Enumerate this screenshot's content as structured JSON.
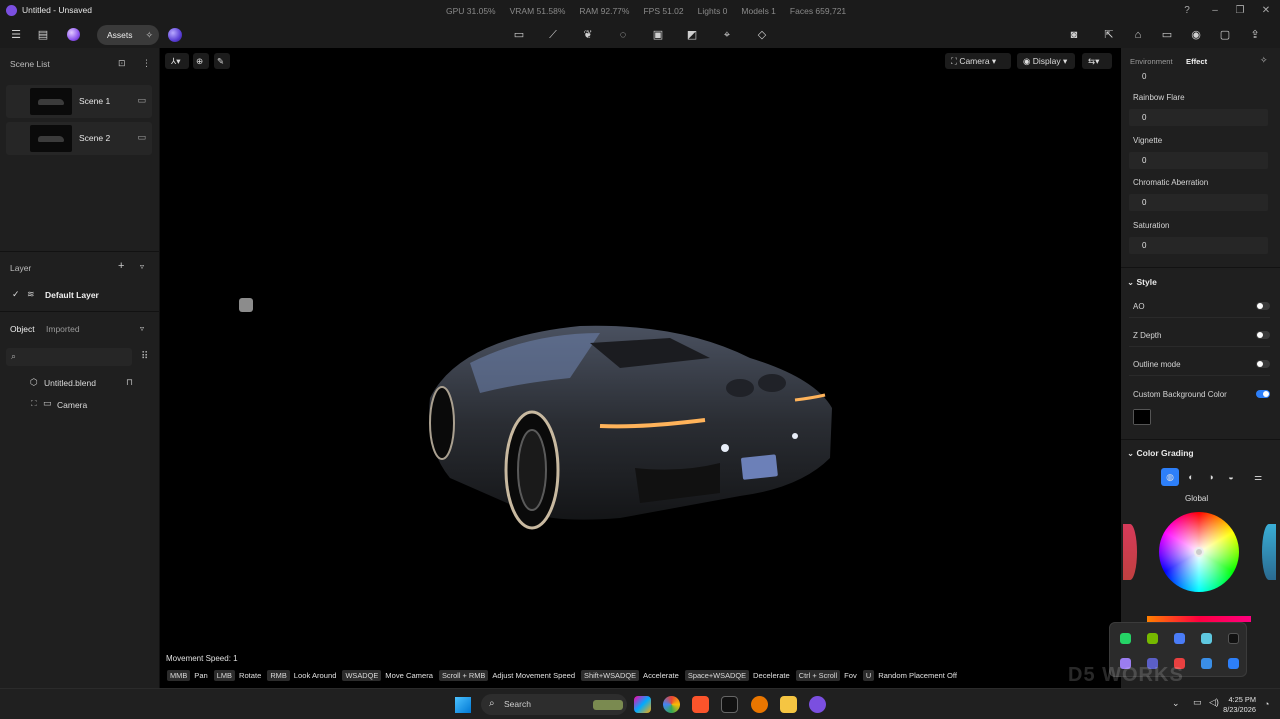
{
  "window": {
    "title": "Untitled - Unsaved"
  },
  "stats": {
    "gpu": "GPU 31.05%",
    "vram": "VRAM 51.58%",
    "ram": "RAM 92.77%",
    "fps": "FPS 51.02",
    "lights": "Lights 0",
    "models": "Models 1",
    "faces": "Faces 659,721"
  },
  "toolbar": {
    "assets_label": "Assets"
  },
  "scene_list": {
    "title": "Scene List",
    "scenes": [
      {
        "label": "Scene 1"
      },
      {
        "label": "Scene 2"
      }
    ]
  },
  "layer": {
    "title": "Layer",
    "default_layer": "Default Layer"
  },
  "object_panel": {
    "tab_object": "Object",
    "tab_imported": "Imported",
    "search_placeholder": "",
    "items": [
      {
        "label": "Untitled.blend"
      },
      {
        "label": "Camera"
      }
    ]
  },
  "viewport": {
    "camera_label": "Camera",
    "display_label": "Display",
    "movement_speed": "Movement Speed: 1",
    "hints": [
      {
        "key": "MMB",
        "action": "Pan"
      },
      {
        "key": "LMB",
        "action": "Rotate"
      },
      {
        "key": "RMB",
        "action": "Look Around"
      },
      {
        "key": "WSADQE",
        "action": "Move Camera"
      },
      {
        "key": "Scroll + RMB",
        "action": "Adjust Movement Speed"
      },
      {
        "key": "Shift+WSADQE",
        "action": "Accelerate"
      },
      {
        "key": "Space+WSADQE",
        "action": "Decelerate"
      },
      {
        "key": "Ctrl + Scroll",
        "action": "Fov"
      },
      {
        "key": "U",
        "action": "Random Placement Off"
      }
    ]
  },
  "right_panel": {
    "tab_environment": "Environment",
    "tab_effect": "Effect",
    "top_value": "0",
    "effects": [
      {
        "label": "Rainbow Flare",
        "value": "0"
      },
      {
        "label": "Vignette",
        "value": "0"
      },
      {
        "label": "Chromatic Aberration",
        "value": "0"
      },
      {
        "label": "Saturation",
        "value": "0"
      }
    ],
    "style_title": "Style",
    "style_toggles": [
      {
        "label": "AO",
        "on": false
      },
      {
        "label": "Z Depth",
        "on": false
      },
      {
        "label": "Outline mode",
        "on": false
      },
      {
        "label": "Custom Background Color",
        "on": true
      }
    ],
    "background_color": "#000000",
    "color_grading_title": "Color Grading",
    "color_grading_mode": "Global"
  },
  "taskbar": {
    "search_label": "Search",
    "time": "4:25 PM",
    "date": "8/23/2026"
  },
  "watermark": "D5 WORKS",
  "colors": {
    "accent": "#2d7ff9",
    "brand": "#7b4fe0",
    "panel": "#1f1f1f",
    "viewport": "#000000"
  }
}
